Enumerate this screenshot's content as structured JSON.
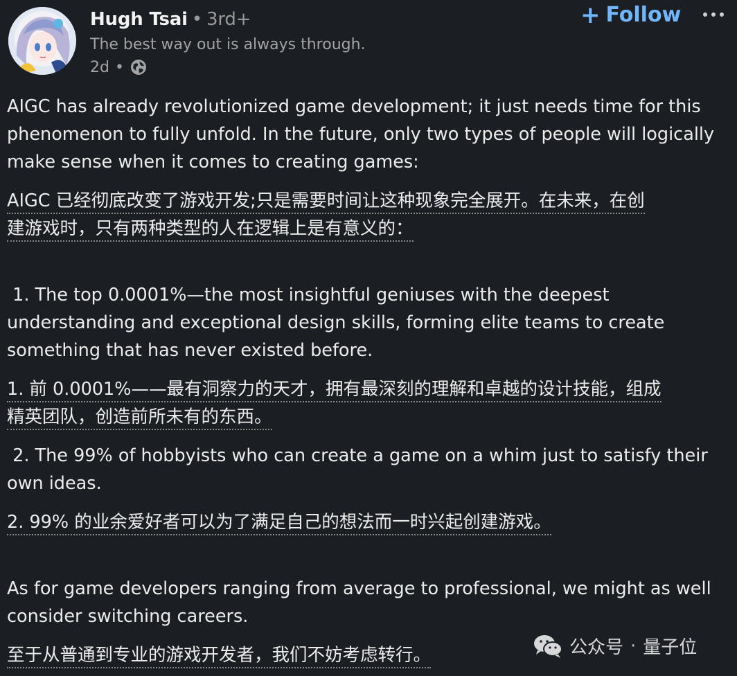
{
  "post": {
    "author": {
      "name": "Hugh Tsai",
      "separator": "•",
      "degree": "3rd+",
      "tagline": "The best way out is always through.",
      "time": "2d",
      "time_separator": "•",
      "avatar_icon": "anime-avatar",
      "visibility_icon": "globe-icon"
    },
    "follow_label": "Follow",
    "follow_color": "#71b7fb",
    "more_icon": "more-options-icon",
    "paragraphs": [
      {
        "lines": [
          "AIGC has already revolutionized game development; it just needs time for this",
          "phenomenon to fully unfold. In the future, only two types of people will logically",
          "make sense when it comes to creating games:"
        ]
      },
      {
        "lines": [
          "AIGC 已经彻底改变了游戏开发;只是需要时间让这种现象完全展开。在未来，在创",
          "建游戏时，只有两种类型的人在逻辑上是有意义的："
        ]
      },
      {
        "lines": [
          " 1. The top 0.0001%—the most insightful geniuses with the deepest",
          "understanding and exceptional design skills, forming elite teams to create",
          "something that has never existed before."
        ]
      },
      {
        "lines": [
          "1. 前 0.0001%——最有洞察力的天才，拥有最深刻的理解和卓越的设计技能，组成",
          "精英团队，创造前所未有的东西。"
        ]
      },
      {
        "lines": [
          " 2. The 99% of hobbyists who can create a game on a whim just to satisfy their",
          "own ideas."
        ]
      },
      {
        "lines": [
          "2. 99% 的业余爱好者可以为了满足自己的想法而一时兴起创建游戏。"
        ]
      },
      {
        "lines": [
          "As for game developers ranging from average to professional, we might as well",
          "consider switching careers."
        ]
      },
      {
        "lines": [
          "至于从普通到专业的游戏开发者，我们不妨考虑转行。"
        ]
      }
    ]
  },
  "watermark": {
    "icon": "wechat-icon",
    "source": "公众号",
    "separator": "·",
    "account": "量子位"
  }
}
